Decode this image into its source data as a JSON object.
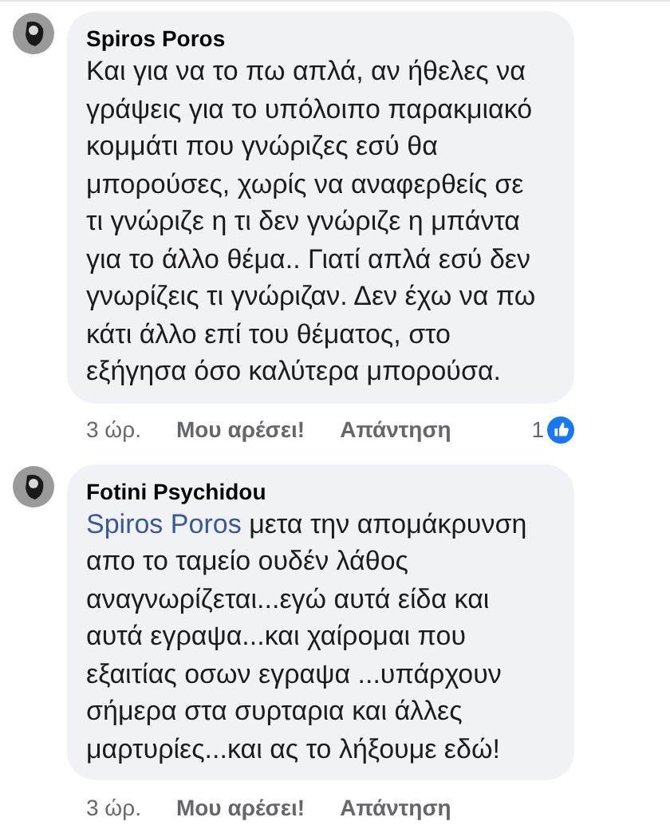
{
  "comments": [
    {
      "author": "Spiros Poros",
      "text": "Και για να το πω απλά, αν ήθελες να γράψεις για το υπόλοιπο παρακμιακό κομμάτι που γνώριζες εσύ θα μπορούσες, χωρίς να αναφερθείς σε τι γνώριζε η τι δεν γνώριζε η μπάντα για το άλλο θέμα.. Γιατί απλά εσύ δεν γνωρίζεις τι γνώριζαν. Δεν έχω να πω κάτι άλλο επί του θέματος, στο εξήγησα όσο καλύτερα μπορούσα.",
      "time": "3 ώρ.",
      "like": "Μου αρέσει!",
      "reply": "Απάντηση",
      "reactions": "1"
    },
    {
      "author": "Fotini Psychidou",
      "mention": "Spiros Poros",
      "text": "μετα την απομάκρυνση απο το ταμείο ουδέν λάθος αναγνωρίζεται...εγώ αυτά είδα και αυτά εγραψα...και χαίρομαι που εξαιτίας οσων εγραψα ...υπάρχουν σήμερα στα συρταρια και άλλες μαρτυρίες...και ας το λήξουμε εδώ!",
      "time": "3 ώρ.",
      "like": "Μου αρέσει!",
      "reply": "Απάντηση"
    }
  ]
}
